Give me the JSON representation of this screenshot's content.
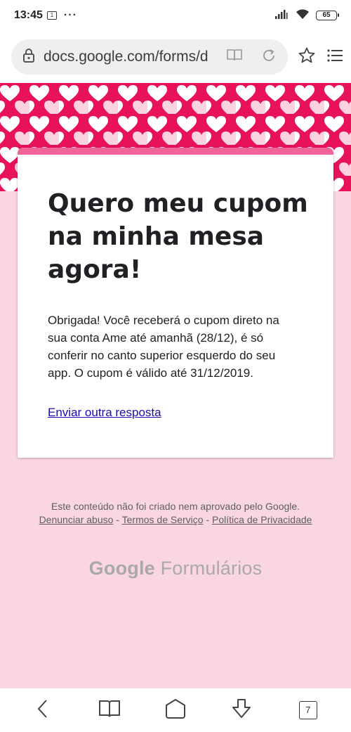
{
  "status_bar": {
    "time": "13:45",
    "notification_badge": "1",
    "more_dots": "···",
    "battery": "65",
    "icons": [
      "signal-icon",
      "wifi-icon",
      "battery-icon"
    ]
  },
  "browser": {
    "url": "docs.google.com/forms/d",
    "icons": [
      "lock-icon",
      "reader-mode-icon",
      "reload-icon",
      "star-icon",
      "menu-list-icon"
    ]
  },
  "colors": {
    "banner": "#e8115b",
    "accent": "#f0649b",
    "background": "#fad6e3",
    "link": "#1a0dab"
  },
  "card": {
    "title": "Quero meu cupom na minha mesa agora!",
    "message": "Obrigada! Você receberá o cupom direto na sua conta Ame até amanhã (28/12), é só conferir no canto superior esquerdo do seu app. O cupom é válido até 31/12/2019.",
    "link": "Enviar outra resposta"
  },
  "footer": {
    "disclaimer": "Este conteúdo não foi criado nem aprovado pelo Google.",
    "report_abuse": "Denunciar abuso",
    "terms": "Termos de Serviço",
    "privacy": "Política de Privacidade",
    "separator": " - "
  },
  "brand": {
    "google": "Google",
    "product": "Formulários"
  },
  "nav": {
    "tab_count": "7",
    "icons": [
      "back-icon",
      "bookmarks-icon",
      "home-icon",
      "download-icon",
      "tabs-icon"
    ]
  }
}
